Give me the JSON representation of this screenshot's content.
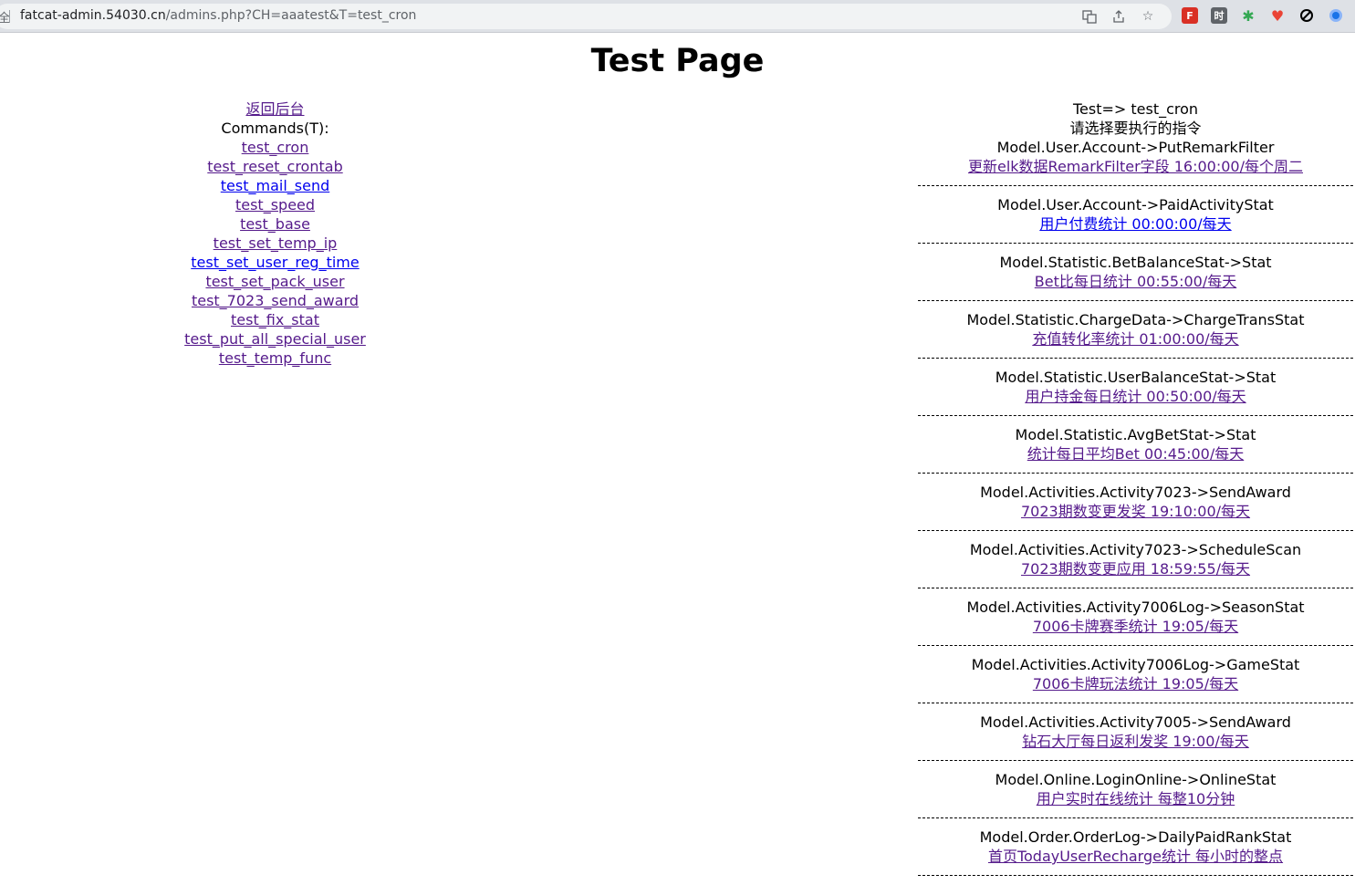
{
  "browser": {
    "url_host": "fatcat-admin.54030.cn",
    "url_path": "/admins.php?CH=aaatest&T=test_cron",
    "left_glyph": "全"
  },
  "page": {
    "title": "Test Page"
  },
  "left": {
    "back_link": "返回后台",
    "commands_label": "Commands(T):",
    "commands": [
      {
        "label": "test_cron",
        "visited": true
      },
      {
        "label": "test_reset_crontab",
        "visited": true
      },
      {
        "label": "test_mail_send",
        "visited": false
      },
      {
        "label": "test_speed",
        "visited": true
      },
      {
        "label": "test_base",
        "visited": true
      },
      {
        "label": "test_set_temp_ip",
        "visited": true
      },
      {
        "label": "test_set_user_reg_time",
        "visited": false
      },
      {
        "label": "test_set_pack_user",
        "visited": true
      },
      {
        "label": "test_7023_send_award",
        "visited": true
      },
      {
        "label": "test_fix_stat",
        "visited": true
      },
      {
        "label": "test_put_all_special_user",
        "visited": true
      },
      {
        "label": "test_temp_func",
        "visited": true
      }
    ]
  },
  "right": {
    "test_line": "Test=> test_cron",
    "prompt": "请选择要执行的指令",
    "entries": [
      {
        "method": "Model.User.Account->PutRemarkFilter",
        "link": "更新elk数据RemarkFilter字段 16:00:00/每个周二",
        "visited": true
      },
      {
        "method": "Model.User.Account->PaidActivityStat",
        "link": "用户付费统计 00:00:00/每天",
        "visited": false
      },
      {
        "method": "Model.Statistic.BetBalanceStat->Stat",
        "link": "Bet比每日统计 00:55:00/每天",
        "visited": true
      },
      {
        "method": "Model.Statistic.ChargeData->ChargeTransStat",
        "link": "充值转化率统计 01:00:00/每天",
        "visited": true
      },
      {
        "method": "Model.Statistic.UserBalanceStat->Stat",
        "link": "用户持金每日统计 00:50:00/每天",
        "visited": true
      },
      {
        "method": "Model.Statistic.AvgBetStat->Stat",
        "link": "统计每日平均Bet 00:45:00/每天",
        "visited": true
      },
      {
        "method": "Model.Activities.Activity7023->SendAward",
        "link": "7023期数变更发奖 19:10:00/每天",
        "visited": true
      },
      {
        "method": "Model.Activities.Activity7023->ScheduleScan",
        "link": "7023期数变更应用 18:59:55/每天",
        "visited": true
      },
      {
        "method": "Model.Activities.Activity7006Log->SeasonStat",
        "link": "7006卡牌赛季统计 19:05/每天",
        "visited": true
      },
      {
        "method": "Model.Activities.Activity7006Log->GameStat",
        "link": "7006卡牌玩法统计 19:05/每天",
        "visited": true
      },
      {
        "method": "Model.Activities.Activity7005->SendAward",
        "link": "钻石大厅每日返利发奖 19:00/每天",
        "visited": true
      },
      {
        "method": "Model.Online.LoginOnline->OnlineStat",
        "link": "用户实时在线统计 每整10分钟",
        "visited": true
      },
      {
        "method": "Model.Order.OrderLog->DailyPaidRankStat",
        "link": "首页TodayUserRecharge统计 每小时的整点",
        "visited": true
      }
    ]
  }
}
